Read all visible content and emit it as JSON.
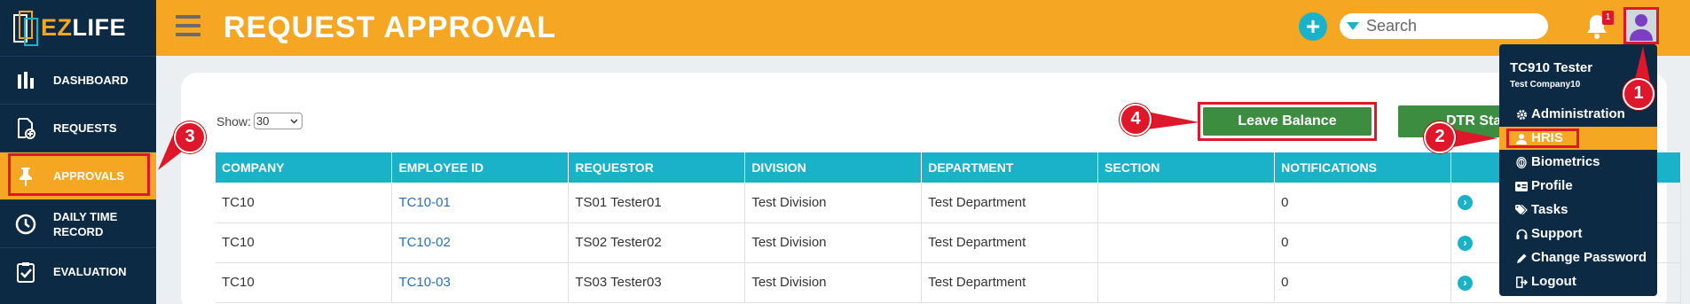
{
  "app": {
    "logo_text_ez": "EZ",
    "logo_text_life": "LIFE"
  },
  "sidebar": {
    "items": [
      {
        "label": "DASHBOARD",
        "icon": "bar-chart-icon"
      },
      {
        "label": "REQUESTS",
        "icon": "document-add-icon"
      },
      {
        "label": "APPROVALS",
        "icon": "pin-icon",
        "active": true
      },
      {
        "label": "DAILY TIME RECORD",
        "icon": "clock-icon"
      },
      {
        "label": "EVALUATION",
        "icon": "checklist-icon"
      }
    ]
  },
  "header": {
    "title": "REQUEST APPROVAL",
    "search_placeholder": "Search",
    "notification_count": "1"
  },
  "main": {
    "show_label": "Show:",
    "show_value": "30",
    "leave_balance_label": "Leave Balance",
    "dtr_label": "DTR Sta",
    "table": {
      "columns": [
        "COMPANY",
        "EMPLOYEE ID",
        "REQUESTOR",
        "DIVISION",
        "DEPARTMENT",
        "SECTION",
        "NOTIFICATIONS",
        ""
      ],
      "rows": [
        [
          "TC10",
          "TC10-01",
          "TS01 Tester01",
          "Test Division",
          "Test Department",
          "",
          "0"
        ],
        [
          "TC10",
          "TC10-02",
          "TS02 Tester02",
          "Test Division",
          "Test Department",
          "",
          "0"
        ],
        [
          "TC10",
          "TC10-03",
          "TS03 Tester03",
          "Test Division",
          "Test Department",
          "",
          "0"
        ]
      ]
    }
  },
  "user_menu": {
    "name": "TC910 Tester",
    "company": "Test Company10",
    "items": [
      {
        "label": "Administration",
        "icon": "gear-icon"
      },
      {
        "label": "HRIS",
        "icon": "user-icon",
        "active": true
      },
      {
        "label": "Biometrics",
        "icon": "fingerprint-icon"
      },
      {
        "label": "Profile",
        "icon": "id-card-icon"
      },
      {
        "label": "Tasks",
        "icon": "tags-icon"
      },
      {
        "label": "Support",
        "icon": "headset-icon"
      },
      {
        "label": "Change Password",
        "icon": "pencil-icon"
      },
      {
        "label": "Logout",
        "icon": "logout-icon"
      }
    ]
  },
  "annotations": {
    "m1": "1",
    "m2": "2",
    "m3": "3",
    "m4": "4"
  },
  "colors": {
    "accent": "#f5a623",
    "navy": "#0d2a45",
    "teal": "#1ab2c8",
    "green": "#3c8d40",
    "marker": "#e0162b"
  }
}
